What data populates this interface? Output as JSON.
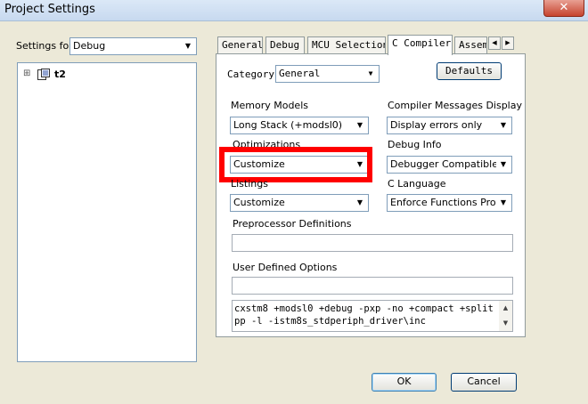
{
  "window": {
    "title": "Project Settings",
    "close_glyph": "✕"
  },
  "settings_for": {
    "label": "Settings for:",
    "value": "Debug"
  },
  "tree": {
    "expand_glyph": "⊞",
    "root_label": "t2"
  },
  "tabs": [
    {
      "label": "General"
    },
    {
      "label": "Debug"
    },
    {
      "label": "MCU Selection"
    },
    {
      "label": "C Compiler"
    },
    {
      "label": "Assembler"
    }
  ],
  "tab_scroll": {
    "left": "◀",
    "right": "▶"
  },
  "compiler": {
    "category_label": "Category",
    "category_value": "General",
    "defaults_button": "Defaults",
    "memory_models": {
      "label": "Memory Models",
      "value": "Long Stack (+modsl0)"
    },
    "messages_display": {
      "label": "Compiler Messages Display",
      "value": "Display errors only"
    },
    "optimizations": {
      "label": "Optimizations",
      "value": "Customize"
    },
    "debug_info": {
      "label": "Debug Info",
      "value": "Debugger Compatible"
    },
    "listings": {
      "label": "Listings",
      "value": "Customize"
    },
    "c_language": {
      "label": "C Language",
      "value": "Enforce Functions Protot"
    },
    "preprocessor": {
      "label": "Preprocessor Definitions",
      "value": ""
    },
    "user_defined": {
      "label": "User Defined Options",
      "value": ""
    },
    "command_line": "cxstm8 +modsl0 +debug -pxp -no +compact +split -\npp -l -istm8s_stdperiph_driver\\inc"
  },
  "buttons": {
    "ok": "OK",
    "cancel": "Cancel"
  },
  "icons": {
    "dropdown": "▼",
    "scroll_up": "▲",
    "scroll_down": "▼"
  },
  "colors": {
    "highlight": "#ff0000",
    "accent_border": "#003c74"
  }
}
